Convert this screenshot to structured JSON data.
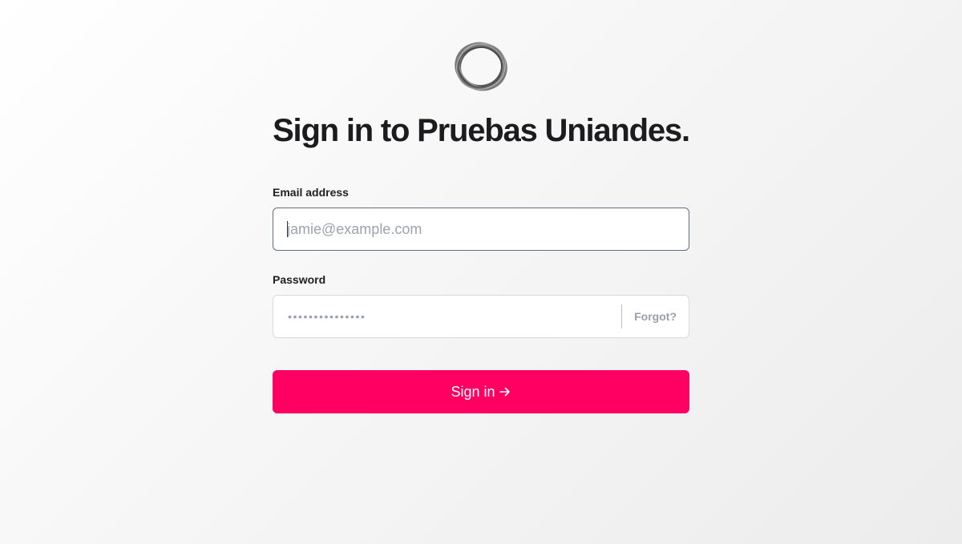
{
  "logo": {
    "icon": "ring-logo-icon"
  },
  "title": "Sign in to Pruebas Uniandes.",
  "email": {
    "label": "Email address",
    "placeholder": "jamie@example.com",
    "value": ""
  },
  "password": {
    "label": "Password",
    "masked_value": "•••••••••••••••",
    "forgot_label": "Forgot?"
  },
  "submit": {
    "label": "Sign in",
    "icon": "arrow-right-icon"
  },
  "colors": {
    "accent": "#ff0062",
    "focus_border": "#5f6f86",
    "muted_text": "#98a0ab"
  }
}
